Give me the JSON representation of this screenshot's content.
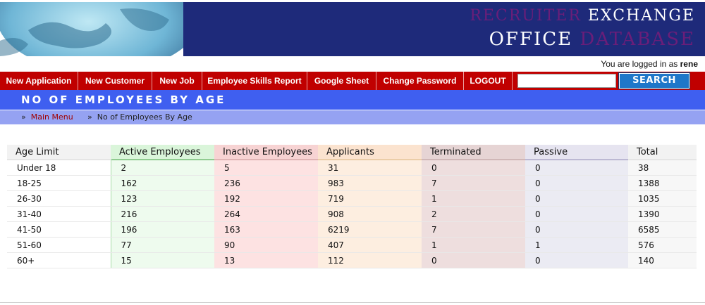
{
  "header": {
    "brand_line1_a": "RECRUITER",
    "brand_line1_b": "EXCHANGE",
    "brand_line2_a": "OFFICE",
    "brand_line2_b": "DATABASE"
  },
  "login": {
    "prefix": "You are logged in as",
    "user": "rene"
  },
  "nav": {
    "items": [
      {
        "label": "New Application"
      },
      {
        "label": "New Customer"
      },
      {
        "label": "New Job"
      },
      {
        "label": "Employee Skills Report"
      },
      {
        "label": "Google Sheet"
      },
      {
        "label": "Change Password"
      },
      {
        "label": "LOGOUT"
      }
    ],
    "search_value": "",
    "search_button": "SEARCH"
  },
  "page": {
    "title": "NO OF EMPLOYEES BY AGE",
    "breadcrumb": {
      "sep": "»",
      "main_menu": "Main Menu",
      "current": "No of Employees By Age"
    }
  },
  "table": {
    "headers": [
      "Age Limit",
      "Active Employees",
      "Inactive Employees",
      "Applicants",
      "Terminated",
      "Passive",
      "Total"
    ],
    "rows": [
      [
        "Under 18",
        "2",
        "5",
        "31",
        "0",
        "0",
        "38"
      ],
      [
        "18-25",
        "162",
        "236",
        "983",
        "7",
        "0",
        "1388"
      ],
      [
        "26-30",
        "123",
        "192",
        "719",
        "1",
        "0",
        "1035"
      ],
      [
        "31-40",
        "216",
        "264",
        "908",
        "2",
        "0",
        "1390"
      ],
      [
        "41-50",
        "196",
        "163",
        "6219",
        "7",
        "0",
        "6585"
      ],
      [
        "51-60",
        "77",
        "90",
        "407",
        "1",
        "1",
        "576"
      ],
      [
        "60+",
        "15",
        "13",
        "112",
        "0",
        "0",
        "140"
      ]
    ]
  },
  "colors": {
    "banner": "#1e2a7a",
    "nav": "#c00000",
    "title_bar": "#3f5ff0",
    "crumb_bar": "#95a2f2",
    "search_button": "#1f77c9"
  },
  "icons": {
    "globe": "globe-image"
  }
}
